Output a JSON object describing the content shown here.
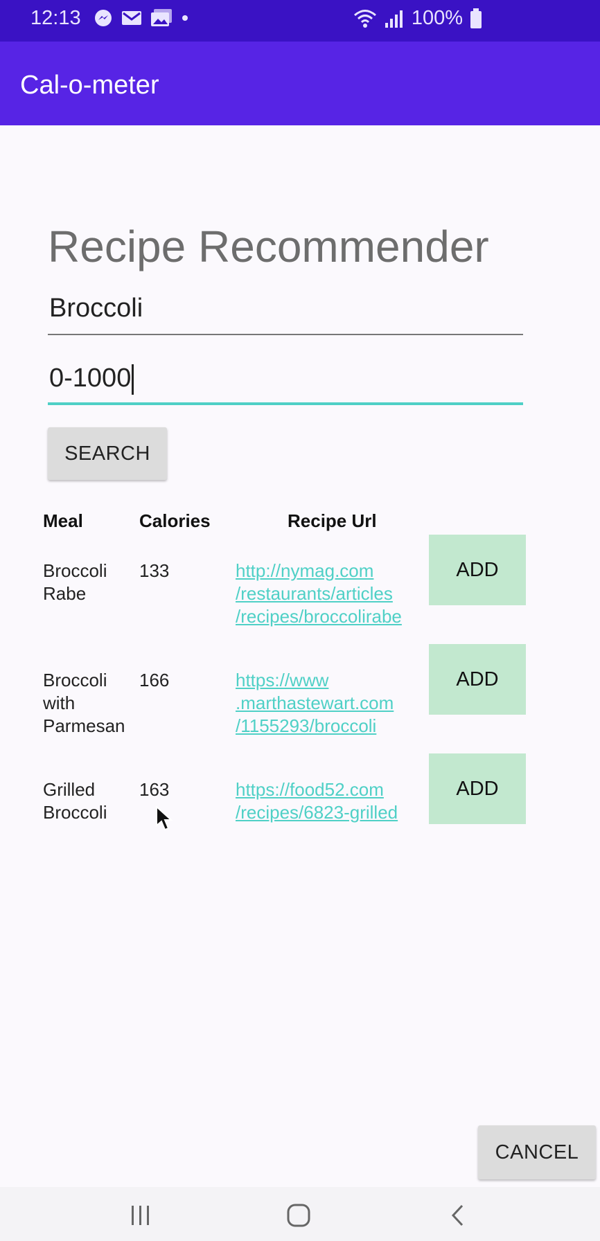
{
  "status_bar": {
    "time": "12:13",
    "battery_text": "100%",
    "icons": [
      "messenger-icon",
      "email-icon",
      "gallery-icon",
      "dot-icon",
      "wifi-icon",
      "signal-icon",
      "battery-icon"
    ]
  },
  "app_bar": {
    "title": "Cal-o-meter"
  },
  "form": {
    "heading": "Recipe Recommender",
    "ingredient_value": "Broccoli",
    "calorie_range_value": "0-1000",
    "search_label": "SEARCH"
  },
  "table": {
    "headers": {
      "meal": "Meal",
      "calories": "Calories",
      "url": "Recipe Url"
    },
    "rows": [
      {
        "meal": "Broccoli\nRabe",
        "calories": "133",
        "url": "http://nymag.com\n/restaurants/articles\n/recipes/broccolirabe",
        "add_label": "ADD"
      },
      {
        "meal": "Broccoli\nwith\nParmesan",
        "calories": "166",
        "url": "https://www\n.marthastewart.com\n/1155293/broccoli",
        "add_label": "ADD"
      },
      {
        "meal": "Grilled\nBroccoli",
        "calories": "163",
        "url": "https://food52.com\n/recipes/6823-grilled",
        "add_label": "ADD"
      }
    ]
  },
  "footer": {
    "cancel_label": "CANCEL"
  },
  "nav_bar": {
    "icons": [
      "recent-apps-icon",
      "home-icon",
      "back-icon"
    ]
  },
  "colors": {
    "status_bar": "#3a12c4",
    "app_bar": "#5724e5",
    "accent": "#4fd0c6",
    "add_button": "#c2e8cf"
  }
}
